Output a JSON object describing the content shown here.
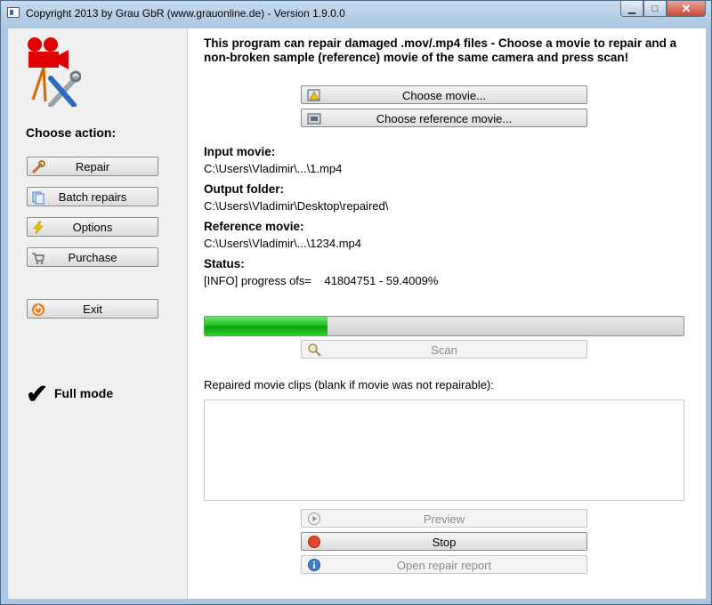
{
  "window": {
    "title": "Copyright 2013 by Grau GbR (www.grauonline.de) - Version 1.9.0.0",
    "minimize_glyph": "▁",
    "maximize_glyph": "□",
    "close_glyph": "✕"
  },
  "sidebar": {
    "logo_icon": "camera-tools-icon",
    "choose_action_label": "Choose action:",
    "buttons": [
      {
        "label": "Repair",
        "icon": "wrench-icon"
      },
      {
        "label": "Batch repairs",
        "icon": "documents-icon"
      },
      {
        "label": "Options",
        "icon": "lightning-icon"
      },
      {
        "label": "Purchase",
        "icon": "cart-icon"
      },
      {
        "label": "Exit",
        "icon": "power-icon"
      }
    ],
    "mode_check": "✔",
    "mode_label": "Full mode"
  },
  "main": {
    "instructions": "This program can repair damaged .mov/.mp4 files - Choose a movie to repair and a non-broken sample (reference) movie of the same camera and press scan!",
    "choose_movie_label": "Choose movie...",
    "choose_reference_label": "Choose reference movie...",
    "input_movie_label": "Input movie:",
    "input_movie_value": "C:\\Users\\Vladimir\\...\\1.mp4",
    "output_folder_label": "Output folder:",
    "output_folder_value": "C:\\Users\\Vladimir\\Desktop\\repaired\\",
    "reference_movie_label": "Reference movie:",
    "reference_movie_value": "C:\\Users\\Vladimir\\...\\1234.mp4",
    "status_label": "Status:",
    "status_value": "[INFO] progress ofs=    41804751 - 59.4009%",
    "progress_fraction": 0.256,
    "progress_color": "#1fbf1f",
    "scan_label": "Scan",
    "clips_label": "Repaired movie clips (blank if movie was not repairable):",
    "preview_label": "Preview",
    "stop_label": "Stop",
    "open_report_label": "Open repair report"
  }
}
